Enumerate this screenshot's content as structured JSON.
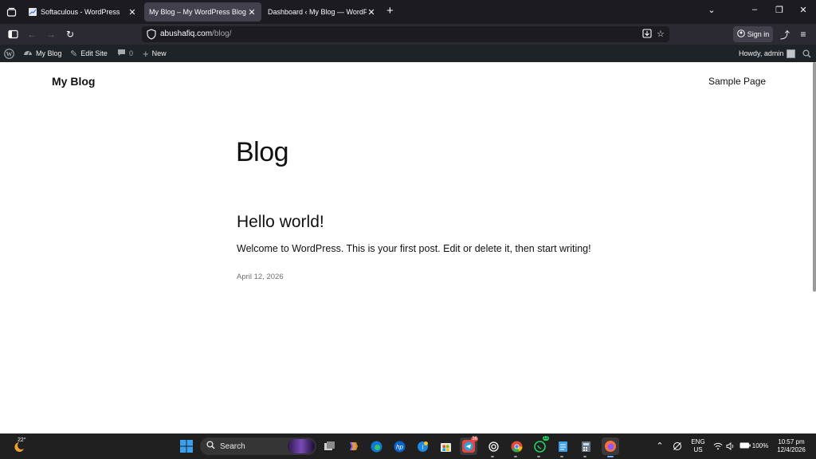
{
  "browser": {
    "tabs": [
      {
        "title": "Softaculous - WordPress",
        "active": false
      },
      {
        "title": "My Blog – My WordPress Blog",
        "active": true
      },
      {
        "title": "Dashboard ‹ My Blog — WordPress",
        "active": false
      }
    ],
    "url_host": "abushafiq.com",
    "url_path": "/blog/",
    "signin_label": "Sign in"
  },
  "adminbar": {
    "site_name": "My Blog",
    "edit_site": "Edit Site",
    "comments_count": "0",
    "new_label": "New",
    "howdy": "Howdy, admin"
  },
  "site": {
    "title": "My Blog",
    "menu_item": "Sample Page"
  },
  "main": {
    "page_title": "Blog",
    "posts": [
      {
        "title": "Hello world!",
        "excerpt": "Welcome to WordPress. This is your first post. Edit or delete it, then start writing!",
        "date": "April 12, 2026"
      }
    ]
  },
  "taskbar": {
    "weather_temp": "22°",
    "search_placeholder": "Search",
    "telegram_badge": "36",
    "whatsapp_badge": "11",
    "lang": "ENG",
    "region": "US",
    "battery": "100%",
    "time": "10:57 pm",
    "date": "12/4/2026"
  },
  "colors": {
    "browser_bg": "#1c1b22",
    "toolbar_bg": "#2b2a33",
    "active_tab": "#42414d",
    "adminbar_bg": "#1d2327",
    "taskbar_bg": "#202020"
  }
}
